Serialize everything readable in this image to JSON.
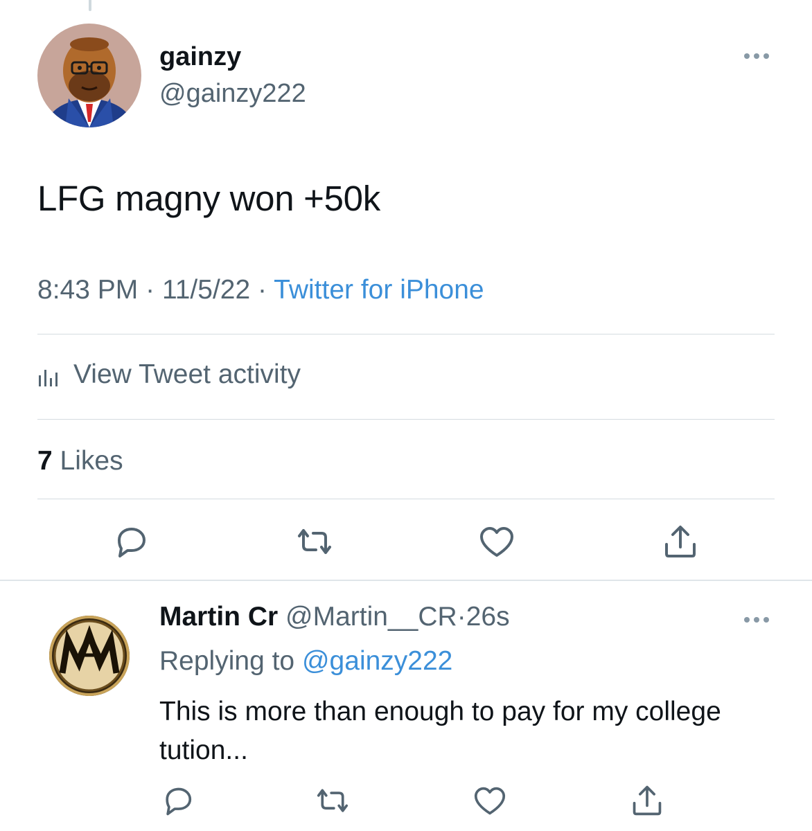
{
  "tweet": {
    "display_name": "gainzy",
    "handle": "@gainzy222",
    "text": "LFG magny won +50k",
    "time": "8:43 PM",
    "separator": "·",
    "date": "11/5/22",
    "source": "Twitter for iPhone",
    "activity_label": "View Tweet activity",
    "likes_count": "7",
    "likes_label": "Likes"
  },
  "reply": {
    "display_name": "Martin Cr",
    "handle": "@Martin__CR",
    "separator": "·",
    "age": "26s",
    "replying_label": "Replying to",
    "replying_to": "@gainzy222",
    "text": "This is more than enough to pay for my college tution..."
  },
  "icons": {
    "more": "more-horizontal-icon",
    "reply": "reply-bubble-icon",
    "retweet": "retweet-icon",
    "like": "heart-icon",
    "share": "share-upload-icon",
    "activity": "bar-chart-icon"
  },
  "colors": {
    "link": "#3b8fd9",
    "secondary_text": "#536471",
    "primary_text": "#0f1419",
    "divider": "#d4dbe0"
  }
}
